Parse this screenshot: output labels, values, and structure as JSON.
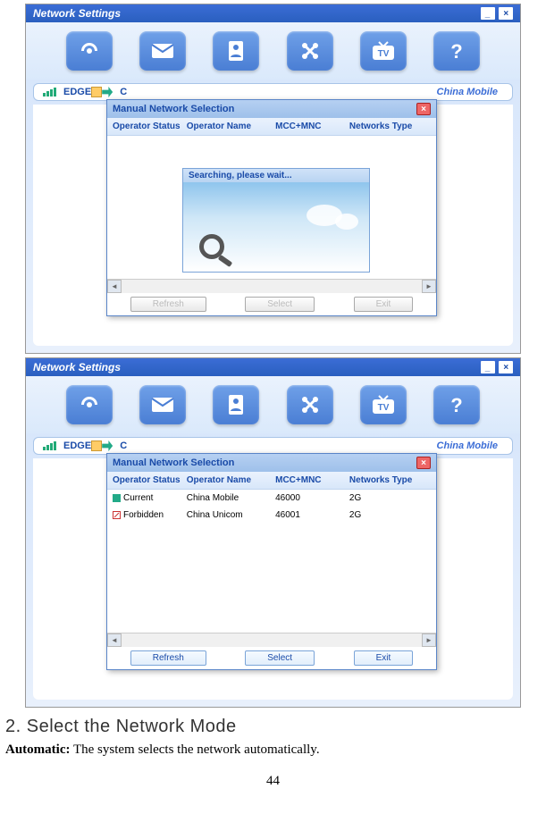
{
  "window": {
    "title": "Network Settings"
  },
  "status": {
    "tech": "EDGE",
    "c_label": "C",
    "carrier": "China Mobile"
  },
  "dialog": {
    "title": "Manual Network Selection",
    "headers": {
      "status": "Operator Status",
      "name": "Operator Name",
      "mcc": "MCC+MNC",
      "type": "Networks Type"
    },
    "searching_text": "Searching, please wait...",
    "rows": [
      {
        "status": "Current",
        "name": "China Mobile",
        "mcc": "46000",
        "type": "2G"
      },
      {
        "status": "Forbidden",
        "name": "China Unicom",
        "mcc": "46001",
        "type": "2G"
      }
    ],
    "buttons": {
      "refresh": "Refresh",
      "select": "Select",
      "exit": "Exit"
    }
  },
  "doc": {
    "heading": "2. Select the Network Mode",
    "automatic_label": "Automatic:",
    "automatic_text": " The system selects the network automatically.",
    "page": "44"
  }
}
